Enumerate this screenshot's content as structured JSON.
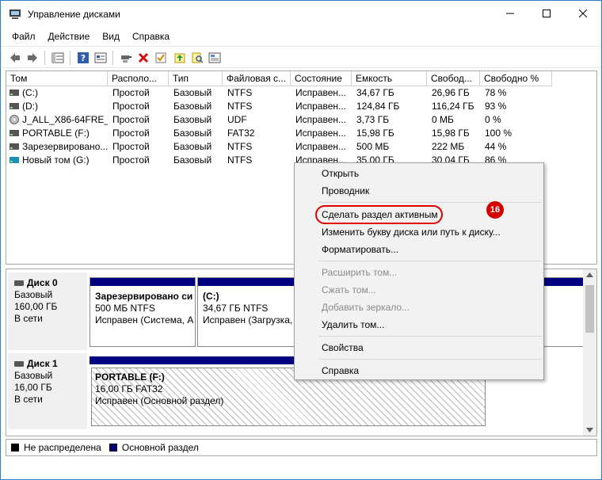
{
  "window": {
    "title": "Управление дисками",
    "minimize_glyph": "—",
    "maximize_glyph": "☐",
    "close_glyph": "✕"
  },
  "menu": [
    "Файл",
    "Действие",
    "Вид",
    "Справка"
  ],
  "toolbar": {
    "icons": [
      "back-arrow-icon",
      "forward-arrow-icon",
      "disk-list-icon",
      "help-icon",
      "properties-icon",
      "connect-icon",
      "delete-icon",
      "check-icon",
      "export-icon",
      "search-icon",
      "view-icon"
    ]
  },
  "volumes": {
    "columns": [
      "Том",
      "Располо...",
      "Тип",
      "Файловая с...",
      "Состояние",
      "Емкость",
      "Свобод...",
      "Свободно %"
    ],
    "rows": [
      {
        "name": "(C:)",
        "layout": "Простой",
        "type": "Базовый",
        "fs": "NTFS",
        "status": "Исправен...",
        "capacity": "34,67 ГБ",
        "free": "26,96 ГБ",
        "free_pct": "78 %"
      },
      {
        "name": "(D:)",
        "layout": "Простой",
        "type": "Базовый",
        "fs": "NTFS",
        "status": "Исправен...",
        "capacity": "124,84 ГБ",
        "free": "116,24 ГБ",
        "free_pct": "93 %"
      },
      {
        "name": "J_ALL_X86-64FRE_...",
        "layout": "Простой",
        "type": "Базовый",
        "fs": "UDF",
        "status": "Исправен...",
        "capacity": "3,73 ГБ",
        "free": "0 МБ",
        "free_pct": "0 %"
      },
      {
        "name": "PORTABLE (F:)",
        "layout": "Простой",
        "type": "Базовый",
        "fs": "FAT32",
        "status": "Исправен...",
        "capacity": "15,98 ГБ",
        "free": "15,98 ГБ",
        "free_pct": "100 %"
      },
      {
        "name": "Зарезервировано...",
        "layout": "Простой",
        "type": "Базовый",
        "fs": "NTFS",
        "status": "Исправен...",
        "capacity": "500 МБ",
        "free": "222 МБ",
        "free_pct": "44 %"
      },
      {
        "name": "Новый том (G:)",
        "layout": "Простой",
        "type": "Базовый",
        "fs": "NTFS",
        "status": "Исправен...",
        "capacity": "35,00 ГБ",
        "free": "30,04 ГБ",
        "free_pct": "86 %"
      }
    ]
  },
  "disks": [
    {
      "title": "Диск 0",
      "type": "Базовый",
      "size": "160,00 ГБ",
      "state": "В сети",
      "partitions": [
        {
          "name": "Зарезервировано си",
          "size": "500 МБ NTFS",
          "status": "Исправен (Система, А"
        },
        {
          "name": "(C:)",
          "size": "34,67 ГБ NTFS",
          "status": "Исправен (Загрузка, Ф"
        }
      ]
    },
    {
      "title": "Диск 1",
      "type": "Базовый",
      "size": "16,00 ГБ",
      "state": "В сети",
      "partitions": [
        {
          "name": "PORTABLE  (F:)",
          "size": "16,00 ГБ FAT32",
          "status": "Исправен (Основной раздел)"
        }
      ]
    }
  ],
  "legend": [
    {
      "label": "Не распределена",
      "color": "#000000"
    },
    {
      "label": "Основной раздел",
      "color": "#000080"
    }
  ],
  "context_menu": {
    "items": [
      {
        "label": "Открыть",
        "enabled": true
      },
      {
        "label": "Проводник",
        "enabled": true
      },
      {
        "label": "Сделать раздел активным",
        "enabled": true
      },
      {
        "label": "Изменить букву диска или путь к диску...",
        "enabled": true
      },
      {
        "label": "Форматировать...",
        "enabled": true
      },
      {
        "label": "Расширить том...",
        "enabled": false
      },
      {
        "label": "Сжать том...",
        "enabled": false
      },
      {
        "label": "Добавить зеркало...",
        "enabled": false
      },
      {
        "label": "Удалить том...",
        "enabled": true
      },
      {
        "label": "Свойства",
        "enabled": true
      },
      {
        "label": "Справка",
        "enabled": true
      }
    ],
    "step_badge": "16"
  },
  "colors": {
    "primary_partition": "#000080",
    "highlight": "#e00000",
    "accent": "#2b7fd1"
  }
}
